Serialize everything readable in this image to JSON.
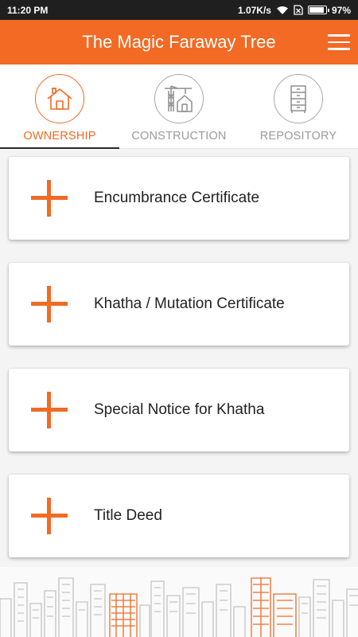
{
  "status_bar": {
    "time": "11:20 PM",
    "speed": "1.07K/s",
    "battery_percent": "97%",
    "battery_level": 0.97
  },
  "app_bar": {
    "title": "The Magic Faraway Tree",
    "menu_icon": "hamburger-menu-icon"
  },
  "tabs": [
    {
      "label": "OWNERSHIP",
      "icon": "house-icon",
      "active": true
    },
    {
      "label": "CONSTRUCTION",
      "icon": "crane-building-icon",
      "active": false
    },
    {
      "label": "REPOSITORY",
      "icon": "cabinet-icon",
      "active": false
    }
  ],
  "cards": [
    {
      "label": "Encumbrance Certificate",
      "icon": "plus-icon"
    },
    {
      "label": "Khatha / Mutation Certificate",
      "icon": "plus-icon"
    },
    {
      "label": "Special Notice for Khatha",
      "icon": "plus-icon"
    },
    {
      "label": "Title Deed",
      "icon": "plus-icon"
    }
  ],
  "colors": {
    "accent": "#f26a24",
    "status_bar": "#1f1f1f",
    "inactive_tab": "#9a9a9a",
    "skyline_gray": "#c8c8c8"
  },
  "footer": {
    "illustration": "city-skyline-illustration"
  }
}
